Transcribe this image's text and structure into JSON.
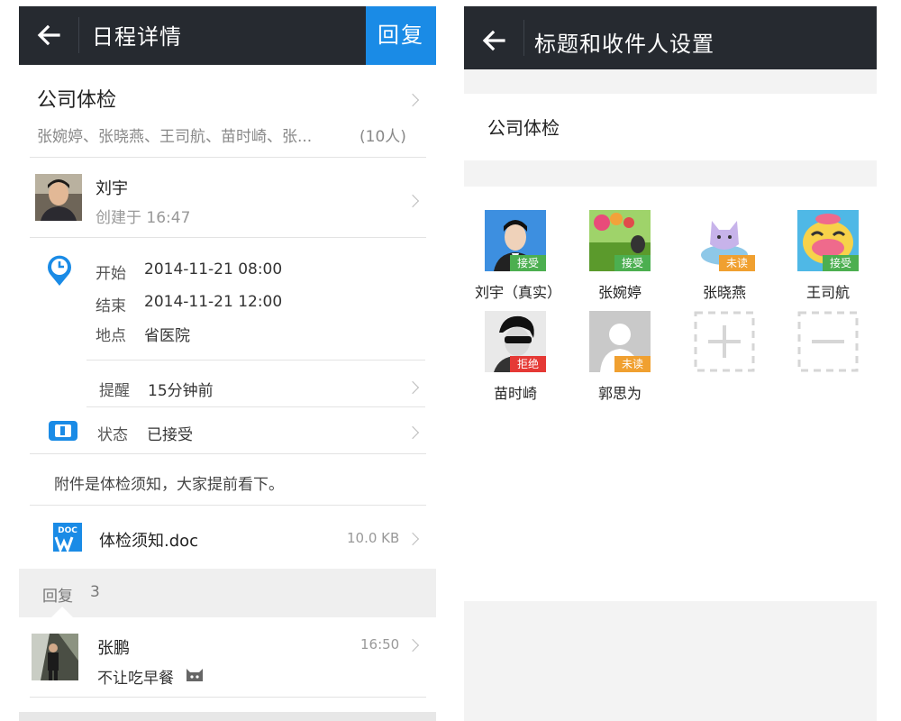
{
  "left": {
    "title": "日程详情",
    "reply_button": "回复",
    "event_title": "公司体检",
    "participants": "张婉婷、张晓燕、王司航、苗时崎、张...",
    "participant_count": "(10人)",
    "creator_name": "刘宇",
    "created_at": "创建于 16:47",
    "start_label": "开始",
    "start_value": "2014-11-21 08:00",
    "end_label": "结束",
    "end_value": "2014-11-21 12:00",
    "location_label": "地点",
    "location_value": "省医院",
    "reminder_label": "提醒",
    "reminder_value": "15分钟前",
    "status_label": "状态",
    "status_value": "已接受",
    "note": "附件是体检须知，大家提前看下。",
    "attachment_name": "体检须知.doc",
    "attachment_size": "10.0 KB",
    "attachment_icon_text": "DOC",
    "replies_label": "回复",
    "replies_count": "3",
    "reply": {
      "author": "张鹏",
      "time": "16:50",
      "text": "不让吃早餐"
    }
  },
  "right": {
    "title": "标题和收件人设置",
    "subject": "公司体检",
    "recipients": [
      {
        "name": "刘宇（真实）",
        "status": "接受",
        "status_color": "#4caf50"
      },
      {
        "name": "张婉婷",
        "status": "接受",
        "status_color": "#4caf50"
      },
      {
        "name": "张晓燕",
        "status": "未读",
        "status_color": "#f0a030"
      },
      {
        "name": "王司航",
        "status": "接受",
        "status_color": "#4caf50"
      },
      {
        "name": "苗时崎",
        "status": "拒绝",
        "status_color": "#e53935"
      },
      {
        "name": "郭思为",
        "status": "未读",
        "status_color": "#f0a030"
      }
    ]
  },
  "colors": {
    "topbar": "#262a30",
    "accent": "#1a8be6"
  }
}
